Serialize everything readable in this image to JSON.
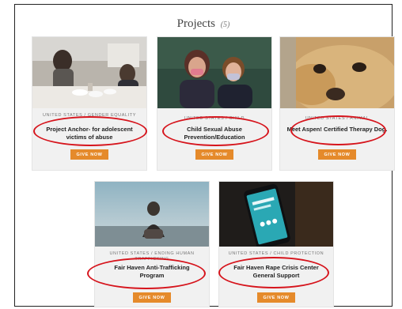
{
  "heading": {
    "title": "Projects",
    "count": "(5)"
  },
  "projects": [
    {
      "meta": "UNITED STATES / GENDER EQUALITY",
      "title": "Project Anchor- for adolescent victims of abuse",
      "button": "GIVE NOW"
    },
    {
      "meta": "UNITED STATES / CHILD",
      "title": "Child Sexual Abuse Prevention/Education",
      "button": "GIVE NOW"
    },
    {
      "meta": "UNITED STATES / ANIMAL",
      "title": "Meet Aspen! Certified Therapy Dog.",
      "button": "GIVE NOW"
    },
    {
      "meta": "UNITED STATES / ENDING HUMAN TRAFFICKING",
      "title": "Fair Haven Anti-Trafficking Program",
      "button": "GIVE NOW"
    },
    {
      "meta": "UNITED STATES / CHILD PROTECTION",
      "title": "Fair Haven Rape Crisis Center General Support",
      "button": "GIVE NOW"
    }
  ],
  "colors": {
    "accent": "#e58a2b",
    "highlight_ring": "#d6141c",
    "card_bg": "#f1f1f1"
  }
}
